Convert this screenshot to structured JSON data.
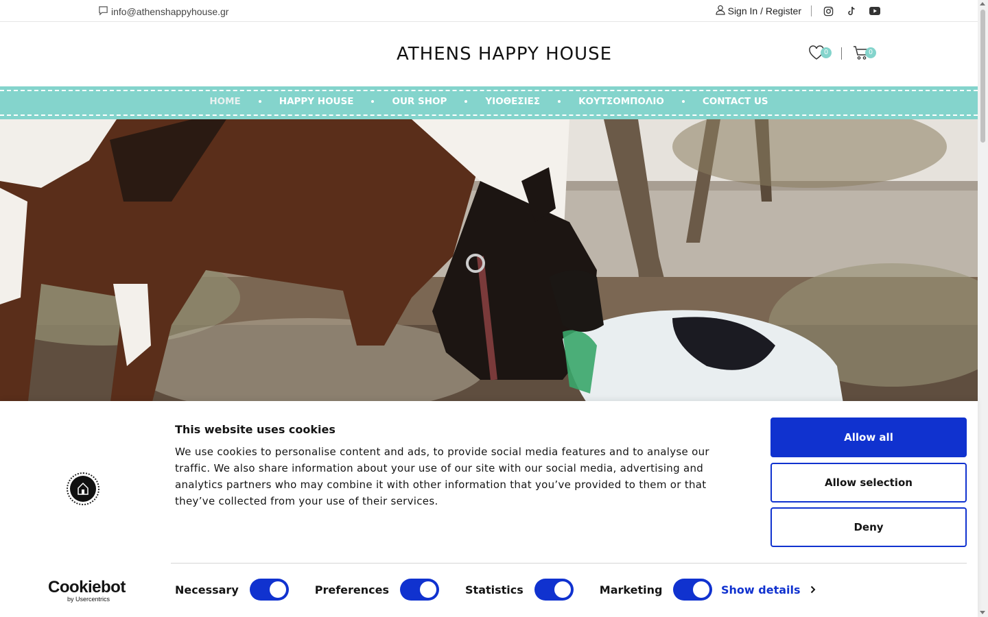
{
  "topbar": {
    "email": "info@athenshappyhouse.gr",
    "signin": "Sign In / Register",
    "social": [
      "instagram-icon",
      "tiktok-icon",
      "youtube-icon"
    ]
  },
  "header": {
    "logo_text": "ATHENS HAPPY HOUSE",
    "wishlist_count": "0",
    "cart_count": "0"
  },
  "nav": {
    "items": [
      "HOME",
      "HAPPY HOUSE",
      "OUR SHOP",
      "ΥΙΟΘΕΣΙΕΣ",
      "ΚΟΥΤΣΟΜΠΟΛΙΟ",
      "CONTACT US"
    ],
    "active": "HOME"
  },
  "cookie": {
    "title": "This website uses cookies",
    "body": "We use cookies to personalise content and ads, to provide social media features and to analyse our traffic. We also share information about your use of our site with our social media, advertising and analytics partners who may combine it with other information that you’ve provided to them or that they’ve collected from your use of their services.",
    "allow_all": "Allow all",
    "allow_selection": "Allow selection",
    "deny": "Deny",
    "brand": "Cookiebot",
    "brand_sub": "by Usercentrics",
    "toggles": [
      "Necessary",
      "Preferences",
      "Statistics",
      "Marketing"
    ],
    "show_details": "Show details"
  },
  "colors": {
    "accent": "#84d4cc",
    "cookie_blue": "#1032cf"
  }
}
